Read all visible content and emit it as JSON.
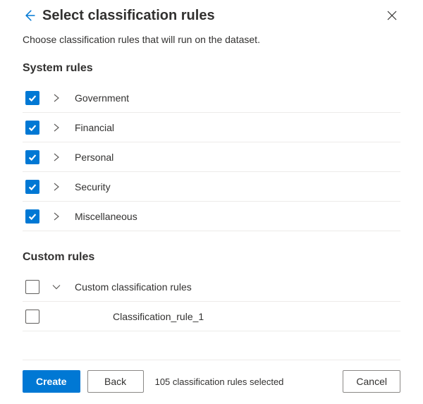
{
  "header": {
    "title": "Select classification rules"
  },
  "description": "Choose classification rules that will run on the dataset.",
  "systemSection": {
    "title": "System rules",
    "rules": [
      {
        "label": "Government",
        "checked": true,
        "expanded": false
      },
      {
        "label": "Financial",
        "checked": true,
        "expanded": false
      },
      {
        "label": "Personal",
        "checked": true,
        "expanded": false
      },
      {
        "label": "Security",
        "checked": true,
        "expanded": false
      },
      {
        "label": "Miscellaneous",
        "checked": true,
        "expanded": false
      }
    ]
  },
  "customSection": {
    "title": "Custom rules",
    "group": {
      "label": "Custom classification rules",
      "checked": false,
      "expanded": true
    },
    "children": [
      {
        "label": "Classification_rule_1",
        "checked": false
      }
    ]
  },
  "footer": {
    "create": "Create",
    "back": "Back",
    "status": "105 classification rules selected",
    "cancel": "Cancel"
  }
}
